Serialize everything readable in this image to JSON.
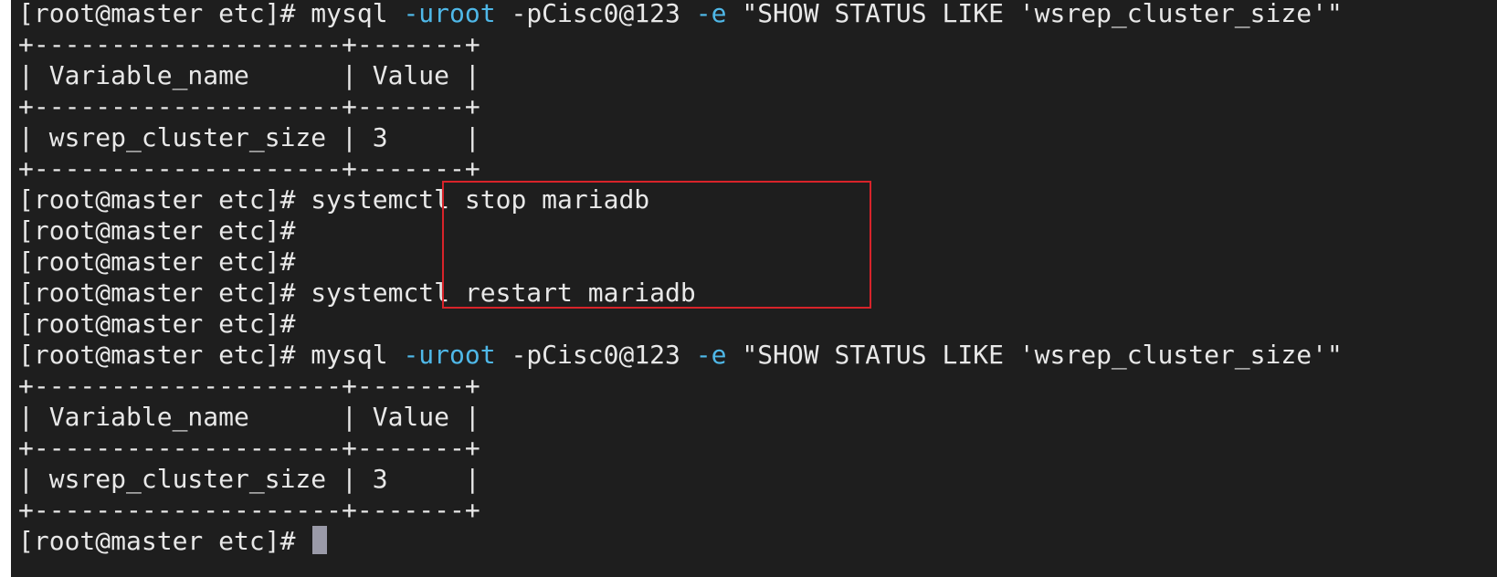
{
  "terminal": {
    "prompt": "[root@master etc]#",
    "lines": [
      {
        "type": "mysql",
        "prompt": "[root@master etc]#",
        "cmd": "mysql",
        "opt1": "-uroot",
        "arg1": "-pCisc0@123",
        "opt2": "-e",
        "str": "\"SHOW STATUS LIKE 'wsrep_cluster_size'\""
      },
      {
        "type": "text",
        "text": "+--------------------+-------+"
      },
      {
        "type": "text",
        "text": "| Variable_name      | Value |"
      },
      {
        "type": "text",
        "text": "+--------------------+-------+"
      },
      {
        "type": "text",
        "text": "| wsrep_cluster_size | 3     |"
      },
      {
        "type": "text",
        "text": "+--------------------+-------+"
      },
      {
        "type": "cmd",
        "prompt": "[root@master etc]#",
        "cmd": "systemctl",
        "rest": "stop mariadb"
      },
      {
        "type": "cmd",
        "prompt": "[root@master etc]#",
        "cmd": "",
        "rest": ""
      },
      {
        "type": "cmd",
        "prompt": "[root@master etc]#",
        "cmd": "",
        "rest": ""
      },
      {
        "type": "cmd",
        "prompt": "[root@master etc]#",
        "cmd": "systemctl",
        "rest": "restart mariadb"
      },
      {
        "type": "cmd",
        "prompt": "[root@master etc]#",
        "cmd": "",
        "rest": ""
      },
      {
        "type": "mysql",
        "prompt": "[root@master etc]#",
        "cmd": "mysql",
        "opt1": "-uroot",
        "arg1": "-pCisc0@123",
        "opt2": "-e",
        "str": "\"SHOW STATUS LIKE 'wsrep_cluster_size'\""
      },
      {
        "type": "text",
        "text": "+--------------------+-------+"
      },
      {
        "type": "text",
        "text": "| Variable_name      | Value |"
      },
      {
        "type": "text",
        "text": "+--------------------+-------+"
      },
      {
        "type": "text",
        "text": "| wsrep_cluster_size | 3     |"
      },
      {
        "type": "text",
        "text": "+--------------------+-------+"
      },
      {
        "type": "final",
        "prompt": "[root@master etc]#"
      }
    ]
  },
  "colors": {
    "background": "#1e1e1e",
    "text": "#e8e8e8",
    "option": "#4fb8e8",
    "highlight_border": "#d8232a",
    "cursor": "#9a9aa8"
  }
}
